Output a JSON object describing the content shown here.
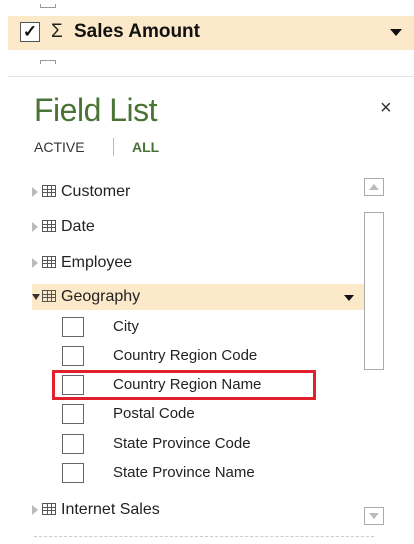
{
  "field_well": {
    "checked": true,
    "check_glyph": "✓",
    "sigma_glyph": "Σ",
    "label": "Sales Amount"
  },
  "field_list": {
    "title": "Field List",
    "close_glyph": "×",
    "tabs": {
      "active": "ACTIVE",
      "all": "ALL"
    },
    "tables": [
      {
        "label": "Customer",
        "expanded": false
      },
      {
        "label": "Date",
        "expanded": false
      },
      {
        "label": "Employee",
        "expanded": false
      },
      {
        "label": "Geography",
        "expanded": true
      },
      {
        "label": "Internet Sales",
        "expanded": false
      }
    ],
    "geography_fields": [
      {
        "label": "City",
        "checked": false
      },
      {
        "label": "Country Region Code",
        "checked": false
      },
      {
        "label": "Country Region Name",
        "checked": false,
        "highlighted": true
      },
      {
        "label": "Postal Code",
        "checked": false
      },
      {
        "label": "State Province Code",
        "checked": false
      },
      {
        "label": "State Province Name",
        "checked": false
      }
    ]
  },
  "colors": {
    "selection_bg": "#fbe9c9",
    "title_green": "#4a7436",
    "highlight_red": "#e0202b"
  }
}
